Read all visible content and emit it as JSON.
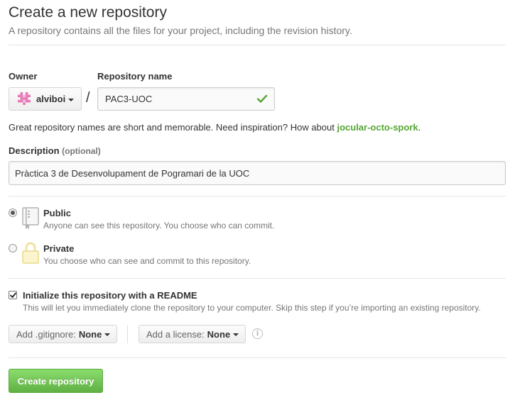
{
  "header": {
    "title": "Create a new repository",
    "subtitle": "A repository contains all the files for your project, including the revision history."
  },
  "owner": {
    "label": "Owner",
    "value": "alviboi",
    "avatar_color": "#e67bb6"
  },
  "separator": "/",
  "repository_name": {
    "label": "Repository name",
    "value": "PAC3-UOC",
    "valid_color": "#55a532"
  },
  "name_hint": {
    "text": "Great repository names are short and memorable. Need inspiration? How about ",
    "suggestion": "jocular-octo-spork",
    "suffix": "."
  },
  "description": {
    "label": "Description",
    "optional": "(optional)",
    "value": "Pràctica 3 de Desenvolupament de Pogramari de la UOC"
  },
  "visibility": {
    "public": {
      "title": "Public",
      "description": "Anyone can see this repository. You choose who can commit.",
      "selected": true,
      "icon": "repo-book-icon"
    },
    "private": {
      "title": "Private",
      "description": "You choose who can see and commit to this repository.",
      "selected": false,
      "icon": "lock-icon"
    }
  },
  "readme": {
    "title": "Initialize this repository with a README",
    "description": "This will let you immediately clone the repository to your computer. Skip this step if you’re importing an existing repository.",
    "checked": true
  },
  "gitignore": {
    "label": "Add .gitignore:",
    "value": "None"
  },
  "license": {
    "label": "Add a license:",
    "value": "None"
  },
  "info_icon": "i",
  "submit": {
    "label": "Create repository",
    "color": "#60b044"
  }
}
